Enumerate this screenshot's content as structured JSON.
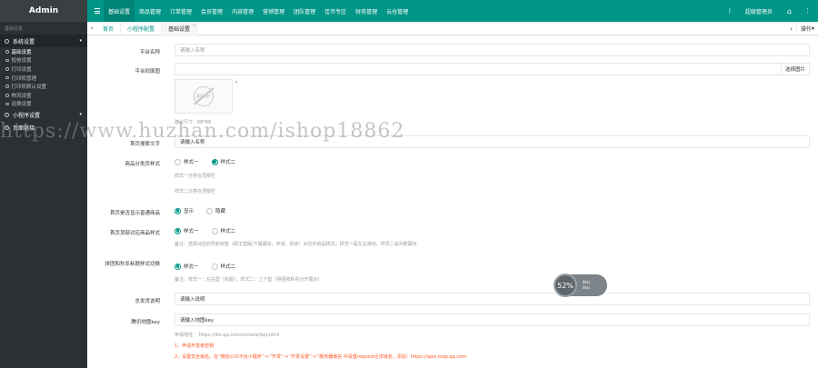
{
  "app": {
    "logo": "Admin"
  },
  "topnav": {
    "items": [
      "基础设置",
      "商品管理",
      "订单管理",
      "会员管理",
      "内容管理",
      "营销管理",
      "团队管理",
      "佳币专区",
      "财务管理",
      "云仓管理"
    ],
    "active_index": 0,
    "admin_label": "超级管理员",
    "sep": "|"
  },
  "sidebar": {
    "header": "基础设置",
    "group_system": "系统设置",
    "items": [
      "基础设置",
      "短信设置",
      "打印设置",
      "打印机管理",
      "打印机默认设置",
      "物流设置",
      "运费设置"
    ],
    "active_index": 0,
    "group_applet": "小程序设置",
    "group_links": "页面链接"
  },
  "tabs": {
    "items": [
      "首页",
      "小程序配置",
      "基础设置"
    ],
    "active_index": 2,
    "op_label": "操作"
  },
  "form": {
    "platform_name_label": "平台名称",
    "platform_name_placeholder": "请输入名称",
    "cover_label": "平台封面图",
    "select_image_btn": "选择图片",
    "image_placeholder": "暂无图片",
    "cover_hint": "建议尺寸：68*68",
    "search_word_label": "首页搜索文字",
    "search_word_value": "请输入名称",
    "category_style_label": "商品分类页样式",
    "category_style_options": [
      "样式一",
      "样式二"
    ],
    "category_style_selected": 1,
    "category_style_hint1": "样式一分类在顶部栏",
    "category_style_hint2": "样式二分类在顶部栏",
    "show_normal_label": "首页是否显示普通商品",
    "show_normal_options": [
      "显示",
      "隐藏"
    ],
    "show_normal_selected": 0,
    "home_tab_label": "首页顶部对应商品样式",
    "home_tab_options": [
      "样式一",
      "样式二"
    ],
    "home_tab_selected": 0,
    "home_tab_hint": "备注：选择对应的导航标签（即主营版/下属版块、步进、秒杀）对应的商品样式，样式一是左右滑动，样式二是列表展示",
    "group_style_label": "拼团和秒杀标题样式切换",
    "group_style_options": [
      "样式一",
      "样式二"
    ],
    "group_style_selected": 0,
    "group_style_hint": "备注：样式一：左右型（标题）；样式二：上下型（拼团和秒杀分开展示）",
    "delivery_label": "总发货说明",
    "delivery_value": "请输入说明",
    "map_key_label": "腾讯地图key",
    "map_key_placeholder": "请输入地图key",
    "map_key_apply": "申请地址： https://lbs.qq.com/console/key.html",
    "note1": "1、申请开发者密钥",
    "note2": "2、设置安全域名。在“微信公众平台小程序”->“开发”->“开发设置”->“服务器域名 中设置request合法域名，添加：https://apis.map.qq.com"
  },
  "watermark": "https://www.huzhan.com/ishop18862",
  "speed_widget": {
    "percent": "52%",
    "up": "0k/s",
    "down": "0k/s"
  },
  "colors": {
    "primary": "#009688",
    "sidebar": "#2b3035",
    "note_red": "#ff5722"
  }
}
